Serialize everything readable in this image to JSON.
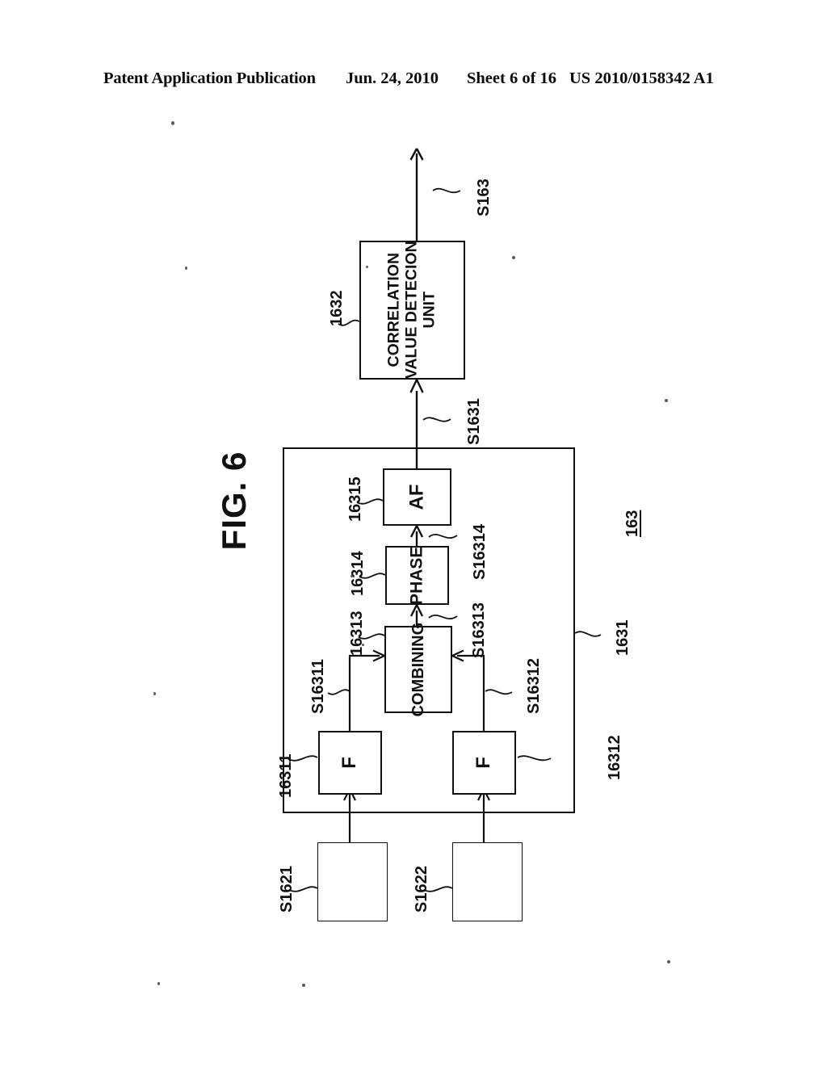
{
  "header": {
    "publication": "Patent Application Publication",
    "date": "Jun. 24, 2010",
    "sheet": "Sheet 6 of 16",
    "patent_number": "US 2010/0158342 A1"
  },
  "figure": {
    "title": "FIG. 6",
    "blocks": {
      "correlation_unit": "CORRELATION\nVALUE DETECION\nUNIT",
      "correlation_unit_line1": "CORRELATION",
      "correlation_unit_line2": "VALUE DETECION",
      "correlation_unit_line3": "UNIT",
      "af": "AF",
      "phase": "PHASE",
      "combining": "COMBINING",
      "filter_left": "F",
      "filter_right": "F",
      "source_left": "",
      "source_right": ""
    },
    "reference_numerals": {
      "correlation_unit": "1632",
      "inner_region": "1631",
      "whole_unit": "163",
      "af": "16315",
      "phase": "16314",
      "combining": "16313",
      "filter_left": "16311",
      "filter_right": "16312"
    },
    "signal_labels": {
      "output": "S163",
      "region_output": "S1631",
      "af_input": "S16314",
      "phase_input": "S16313",
      "combining_input_left": "S16311",
      "combining_input_right": "S16312",
      "source_left_output": "S1621",
      "source_right_output": "S1622"
    }
  },
  "colors": {
    "ink": "#111111",
    "paper": "#ffffff"
  }
}
